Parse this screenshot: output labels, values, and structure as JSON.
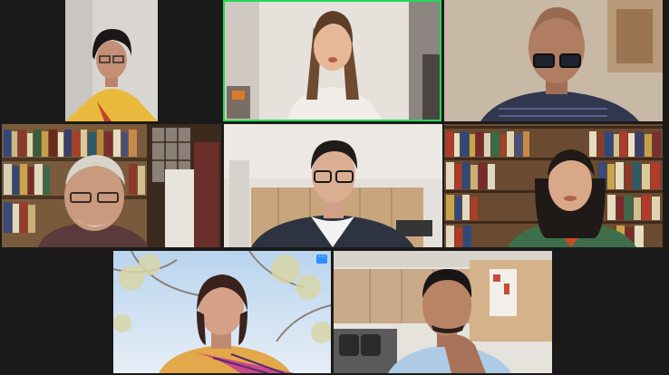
{
  "meeting": {
    "layout": "gallery-view",
    "active_speaker_color": "#23d959",
    "participants": [
      {
        "id": "p1",
        "row": 1,
        "col": 1,
        "name": ""
      },
      {
        "id": "p2",
        "row": 1,
        "col": 2,
        "name": "",
        "active_speaker": true
      },
      {
        "id": "p3",
        "row": 1,
        "col": 3,
        "name": ""
      },
      {
        "id": "p4",
        "row": 2,
        "col": 1,
        "name": ""
      },
      {
        "id": "p5",
        "row": 2,
        "col": 2,
        "name": ""
      },
      {
        "id": "p6",
        "row": 2,
        "col": 3,
        "name": ""
      },
      {
        "id": "p7",
        "row": 3,
        "col": 1,
        "name": "",
        "has_menu": true
      },
      {
        "id": "p8",
        "row": 3,
        "col": 2,
        "name": ""
      }
    ],
    "more_button": {
      "label": "···",
      "icon": "more-options-icon",
      "color": "#2d8cff"
    }
  }
}
